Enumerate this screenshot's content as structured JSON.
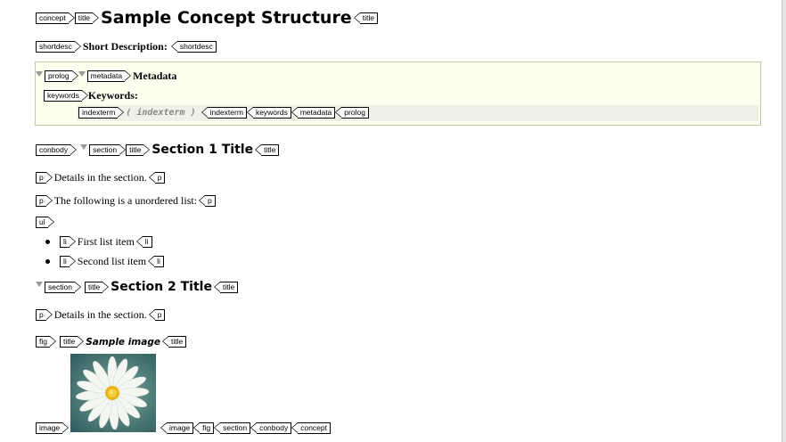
{
  "concept": {
    "open_tag": "concept",
    "title_open_tag": "title",
    "title": "Sample Concept Structure",
    "title_close_tag": "title"
  },
  "shortdesc": {
    "open_tag": "shortdesc",
    "label": "Short Description:",
    "close_tag": "shortdesc"
  },
  "prolog": {
    "open_tag": "prolog",
    "metadata_open_tag": "metadata",
    "metadata_label": "Metadata",
    "keywords_open_tag": "keywords",
    "keywords_label": "Keywords:",
    "indexterm_open_tag": "indexterm",
    "indexterm_placeholder": "( indexterm )",
    "indexterm_close_tag": "indexterm",
    "keywords_close_tag": "keywords",
    "metadata_close_tag": "metadata",
    "close_tag": "prolog"
  },
  "conbody": {
    "open_tag": "conbody",
    "close_tag": "conbody"
  },
  "section1": {
    "open_tag": "section",
    "title_open_tag": "title",
    "title": "Section 1 Title",
    "title_close_tag": "title",
    "p_tag": "p",
    "p1": "Details in the section.",
    "p2": "The following is a unordered list:",
    "ul_tag": "ul",
    "li_tag": "li",
    "items": [
      "First list item",
      "Second list item"
    ]
  },
  "section2": {
    "open_tag": "section",
    "title_open_tag": "title",
    "title": "Section 2 Title",
    "title_close_tag": "title",
    "p_tag": "p",
    "p1": "Details in the section.",
    "close_tag": "section"
  },
  "fig": {
    "open_tag": "fig",
    "title_open_tag": "title",
    "title": "Sample image",
    "title_close_tag": "title",
    "image_open_tag": "image",
    "image_close_tag": "image",
    "close_tag": "fig",
    "image_subject": "daisy-flower"
  }
}
